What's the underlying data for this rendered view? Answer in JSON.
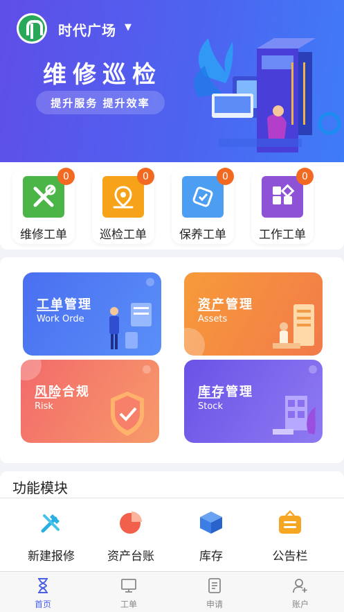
{
  "header": {
    "site_name": "时代广场",
    "caret": "▼",
    "hero_title": "维修巡检",
    "hero_slogan": "提升服务 提升效率"
  },
  "quick_orders": [
    {
      "label": "维修工单",
      "count": "0",
      "icon": "tools-icon",
      "color": "#4cb548"
    },
    {
      "label": "巡检工单",
      "count": "0",
      "icon": "location-pin-icon",
      "color": "#f6a31a"
    },
    {
      "label": "保养工单",
      "count": "0",
      "icon": "maintenance-tag-icon",
      "color": "#4c9ef2"
    },
    {
      "label": "工作工单",
      "count": "0",
      "icon": "grid-apps-icon",
      "color": "#8e52d6"
    }
  ],
  "management": [
    {
      "title": "工单管理",
      "subtitle": "Work Orde"
    },
    {
      "title": "资产管理",
      "subtitle": "Assets"
    },
    {
      "title": "风险合规",
      "subtitle": "Risk"
    },
    {
      "title": "库存管理",
      "subtitle": "Stock"
    }
  ],
  "functions": {
    "title": "功能模块",
    "items": [
      {
        "label": "新建报修",
        "icon": "repair-tools-icon"
      },
      {
        "label": "资产台账",
        "icon": "pie-chart-icon"
      },
      {
        "label": "库存",
        "icon": "cube-icon"
      },
      {
        "label": "公告栏",
        "icon": "bulletin-board-icon"
      }
    ]
  },
  "nav": [
    {
      "label": "首页",
      "icon": "hourglass-home-icon",
      "active": true
    },
    {
      "label": "工单",
      "icon": "monitor-icon",
      "active": false
    },
    {
      "label": "申请",
      "icon": "document-icon",
      "active": false
    },
    {
      "label": "账户",
      "icon": "user-add-icon",
      "active": false
    }
  ],
  "colors": {
    "header_start": "#5f4ee8",
    "header_end": "#3f7cf7",
    "badge": "#f26a21",
    "nav_active": "#4a5ee8"
  }
}
